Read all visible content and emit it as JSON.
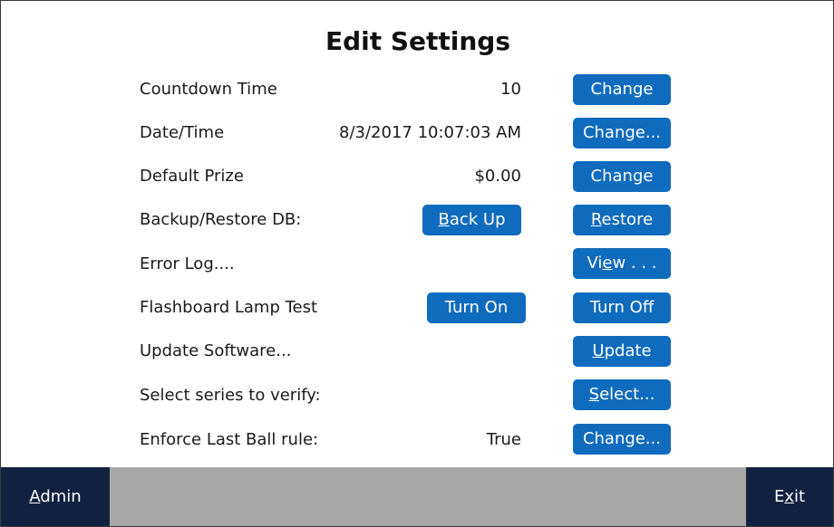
{
  "title": "Edit Settings",
  "rows": {
    "countdown": {
      "label": "Countdown Time",
      "value": "10",
      "button": "Change"
    },
    "datetime": {
      "label": "Date/Time",
      "value": "8/3/2017 10:07:03 AM",
      "button": "Change..."
    },
    "prize": {
      "label": "Default Prize",
      "value": "$0.00",
      "button": "Change"
    },
    "backup": {
      "label": "Backup/Restore DB:",
      "backup_first": "B",
      "backup_rest": "ack Up",
      "restore_first": "R",
      "restore_rest": "estore"
    },
    "errorlog": {
      "label": "Error Log....",
      "view_pre": "Vi",
      "view_ul": "e",
      "view_post": "w . . ."
    },
    "lamp": {
      "label": "Flashboard Lamp Test",
      "on": "Turn On",
      "off": "Turn Off"
    },
    "update": {
      "label": "Update Software...",
      "btn_first": "U",
      "btn_rest": "pdate"
    },
    "series": {
      "label": "Select series to verify:",
      "btn_first": "S",
      "btn_rest": "elect..."
    },
    "lastball": {
      "label": "Enforce Last Ball rule:",
      "value": "True",
      "button": "Change..."
    }
  },
  "footer": {
    "admin_first": "A",
    "admin_rest": "dmin",
    "exit_pre": "E",
    "exit_ul": "x",
    "exit_post": "it"
  },
  "colors": {
    "button": "#0f6bbd",
    "footer_button": "#10223f",
    "footer_bar": "#a6a6a6"
  }
}
